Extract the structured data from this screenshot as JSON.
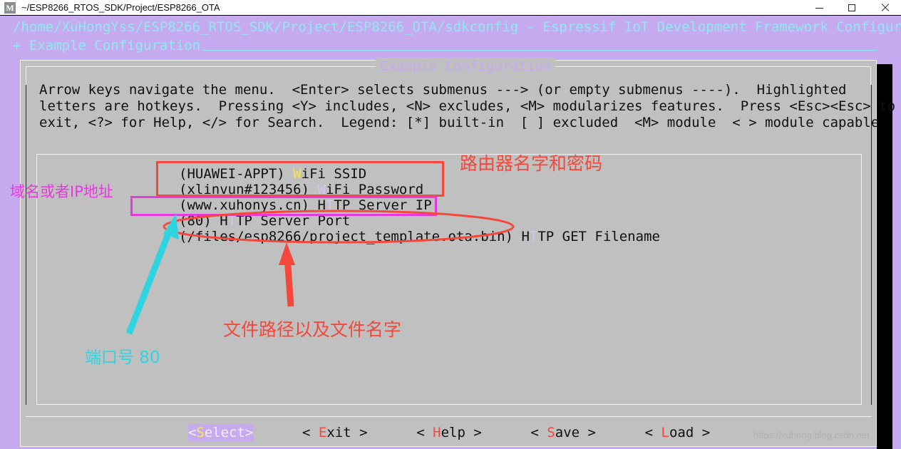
{
  "window": {
    "title": "~/ESP8266_RTOS_SDK/Project/ESP8266_OTA",
    "icon": "M",
    "minimize_label": "–",
    "maximize_label": "□",
    "close_label": "×"
  },
  "menuconfig": {
    "header_line1": "/home/XuHongYss/ESP8266_RTOS_SDK/Project/ESP8266_OTA/sdkconfig - Espressif IoT Development Framework Configuration",
    "header_line2": "+ Example Configuration",
    "dialog_title": "Example Configuration",
    "help_line1": "Arrow keys navigate the menu.  <Enter> selects submenus ---> (or empty submenus ----).  Highlighted",
    "help_line2": "letters are hotkeys.  Pressing <Y> includes, <N> excludes, <M> modularizes features.  Press <Esc><Esc> to",
    "help_line3": "exit, <?> for Help, </> for Search.  Legend: [*] built-in  [ ] excluded  <M> module  < > module capable",
    "items": [
      {
        "value": "(HUAWEI-APPT)",
        "label_pre": " ",
        "hotkey": "W",
        "label_post": "iFi SSID",
        "selected": true
      },
      {
        "value": "(xlinvun#123456)",
        "label_pre": " ",
        "hotkey": "W",
        "label_post": "iFi Password",
        "selected": false
      },
      {
        "value": "(www.xuhonys.cn)",
        "label_pre": " H",
        "hotkey": "T",
        "label_post": "TP Server IP",
        "selected": false
      },
      {
        "value": "(80)",
        "label_pre": " H",
        "hotkey": "T",
        "label_post": "TP Server Port",
        "selected": false
      },
      {
        "value": "(/files/esp8266/project_template.ota.bin)",
        "label_pre": " H",
        "hotkey": "T",
        "label_post": "TP GET Filename",
        "selected": false
      }
    ],
    "buttons": [
      {
        "open": "<",
        "hotkey": "S",
        "rest": "elect",
        "close": ">",
        "selected": true,
        "spaced": false
      },
      {
        "open": "<",
        "hotkey": "E",
        "rest": "xit",
        "close": ">",
        "selected": false,
        "spaced": true
      },
      {
        "open": "<",
        "hotkey": "H",
        "rest": "elp",
        "close": ">",
        "selected": false,
        "spaced": true
      },
      {
        "open": "<",
        "hotkey": "S",
        "rest": "ave",
        "close": ">",
        "selected": false,
        "spaced": true
      },
      {
        "open": "<",
        "hotkey": "L",
        "rest": "oad",
        "close": ">",
        "selected": false,
        "spaced": true
      }
    ]
  },
  "annotations": {
    "router_note": "路由器名字和密码",
    "ip_note": "域名或者IP地址",
    "file_note": "文件路径以及文件名字",
    "port_note": "端口号 80"
  },
  "watermark": "https://xuhong.blog.csdn.net",
  "colors": {
    "terminal_bg": "#c6aaf0",
    "dialog_bg": "#c0c0c0",
    "header_cyan": "#8ee9f0",
    "hotkey_yellow": "#f5e94f",
    "hotkey_red": "#f4483c",
    "annotation_red": "#f4483c",
    "annotation_cyan": "#2fd4e0",
    "annotation_magenta": "#e838e0"
  }
}
